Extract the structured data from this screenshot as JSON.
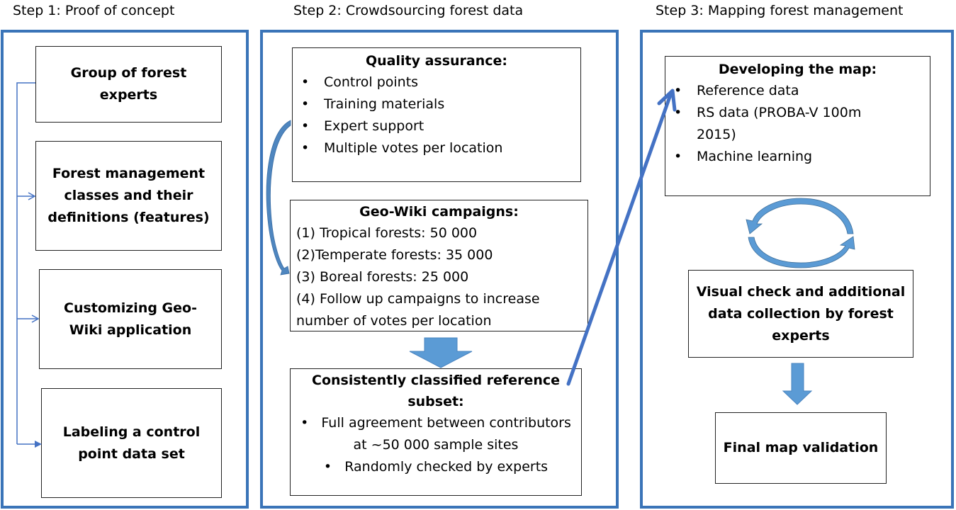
{
  "colors": {
    "panel_border": "#3a74b8",
    "arrow_fill": "#5b9bd5",
    "arrow_line": "#4472c4"
  },
  "steps": [
    {
      "title": "Step 1: Proof of concept",
      "boxes": [
        {
          "text": "Group of forest experts"
        },
        {
          "text": "Forest management classes and their definitions (features)"
        },
        {
          "text": "Customizing Geo-Wiki application"
        },
        {
          "text": "Labeling a control point data set"
        }
      ]
    },
    {
      "title": "Step 2: Crowdsourcing forest data",
      "quality": {
        "heading": "Quality assurance:",
        "items": [
          "Control points",
          "Training materials",
          "Expert support",
          "Multiple votes per location"
        ]
      },
      "campaigns": {
        "heading": "Geo-Wiki campaigns:",
        "items": [
          "(1) Tropical forests: 50 000",
          "(2)Temperate forests: 35 000",
          "(3) Boreal forests: 25 000",
          "(4) Follow up campaigns to increase number of votes per location"
        ]
      },
      "subset": {
        "heading": "Consistently classified reference subset:",
        "items": [
          "Full agreement between contributors  at ~50 000 sample sites",
          "Randomly checked by experts"
        ]
      }
    },
    {
      "title": "Step 3: Mapping forest management",
      "developing": {
        "heading": "Developing the map:",
        "items": [
          "Reference data",
          "RS data (PROBA-V 100m 2015)",
          "Machine learning"
        ]
      },
      "visual_check": {
        "text": "Visual check and additional data collection by forest experts"
      },
      "final": {
        "text": "Final map validation"
      }
    }
  ]
}
